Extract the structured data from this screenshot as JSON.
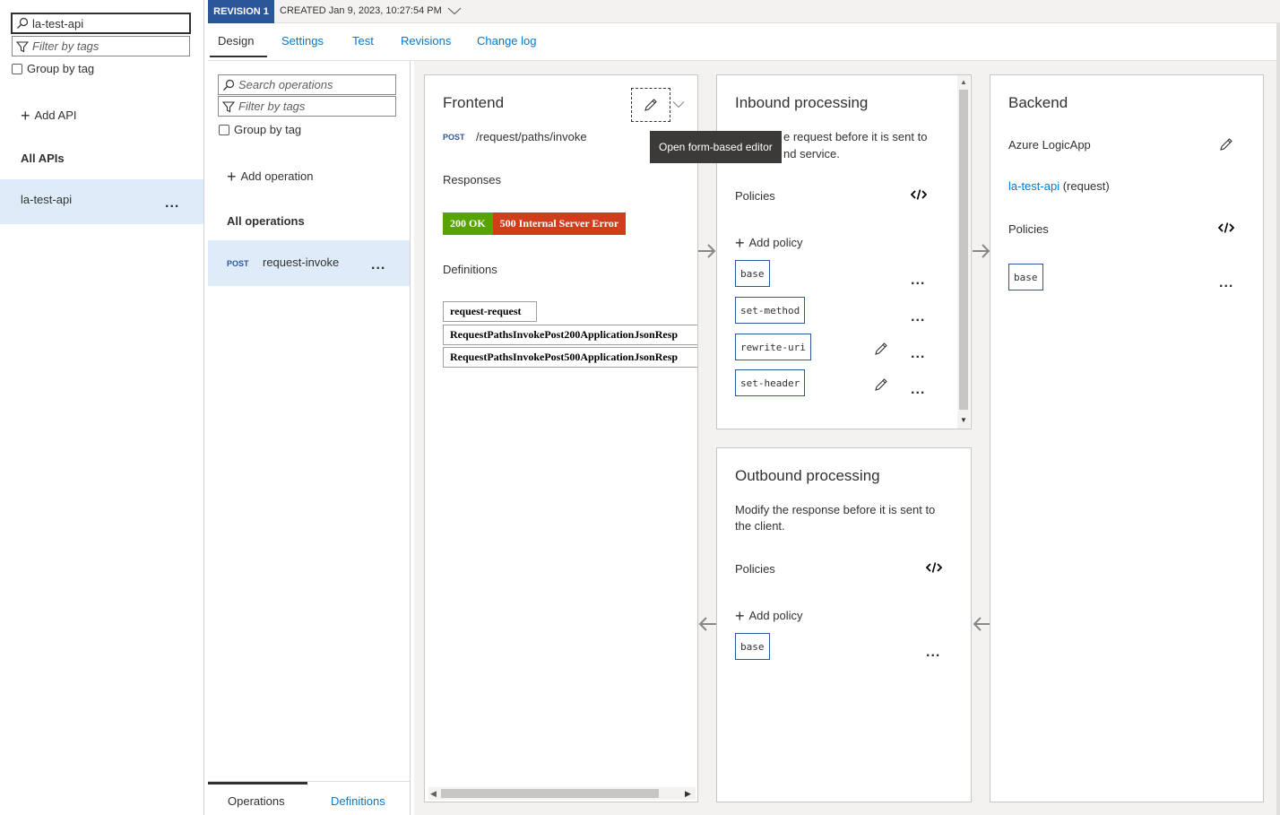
{
  "left": {
    "search_value": "la-test-api",
    "filter_placeholder": "Filter by tags",
    "group_by_tag": "Group by tag",
    "add_api": "Add API",
    "all_apis": "All APIs",
    "api_item": "la-test-api",
    "more": "..."
  },
  "revision": {
    "badge": "REVISION 1",
    "created": "CREATED Jan 9, 2023, 10:27:54 PM"
  },
  "tabs": [
    "Design",
    "Settings",
    "Test",
    "Revisions",
    "Change log"
  ],
  "operations": {
    "search_placeholder": "Search operations",
    "filter_placeholder": "Filter by tags",
    "group_by_tag": "Group by tag",
    "add_operation": "Add operation",
    "all_operations": "All operations",
    "item_method": "POST",
    "item_name": "request-invoke",
    "more": "...",
    "bottom_tabs": [
      "Operations",
      "Definitions"
    ]
  },
  "frontend": {
    "title": "Frontend",
    "method": "POST",
    "path": "/request/paths/invoke",
    "responses_label": "Responses",
    "resp_200": "200 OK",
    "resp_500": "500 Internal Server Error",
    "definitions_label": "Definitions",
    "definitions": [
      "request-request",
      "RequestPathsInvokePost200ApplicationJsonResp",
      "RequestPathsInvokePost500ApplicationJsonResp"
    ],
    "tooltip": "Open form-based editor"
  },
  "inbound": {
    "title": "Inbound processing",
    "desc_line1": "e request before it is sent to",
    "desc_line2": "nd service.",
    "policies_label": "Policies",
    "add_policy": "Add policy",
    "policies": [
      "base",
      "set-method",
      "rewrite-uri",
      "set-header"
    ],
    "more": "..."
  },
  "outbound": {
    "title": "Outbound processing",
    "desc_line1": "Modify the response before it is sent to",
    "desc_line2": "the client.",
    "policies_label": "Policies",
    "add_policy": "Add policy",
    "policies": [
      "base"
    ],
    "more": "..."
  },
  "backend": {
    "title": "Backend",
    "type": "Azure LogicApp",
    "link": "la-test-api",
    "link_suffix": "(request)",
    "policies_label": "Policies",
    "policies": [
      "base"
    ],
    "more": "..."
  },
  "colors": {
    "accent": "#0078d4",
    "revision_badge": "#2b579a",
    "ok_200": "#57a300",
    "err_500": "#d13d1b",
    "selected_row": "#deecf9"
  },
  "icons": [
    "search-icon",
    "filter-icon",
    "plus-icon",
    "pencil-icon",
    "chevron-down-icon",
    "code-icon",
    "arrow-right-icon",
    "arrow-left-icon"
  ]
}
